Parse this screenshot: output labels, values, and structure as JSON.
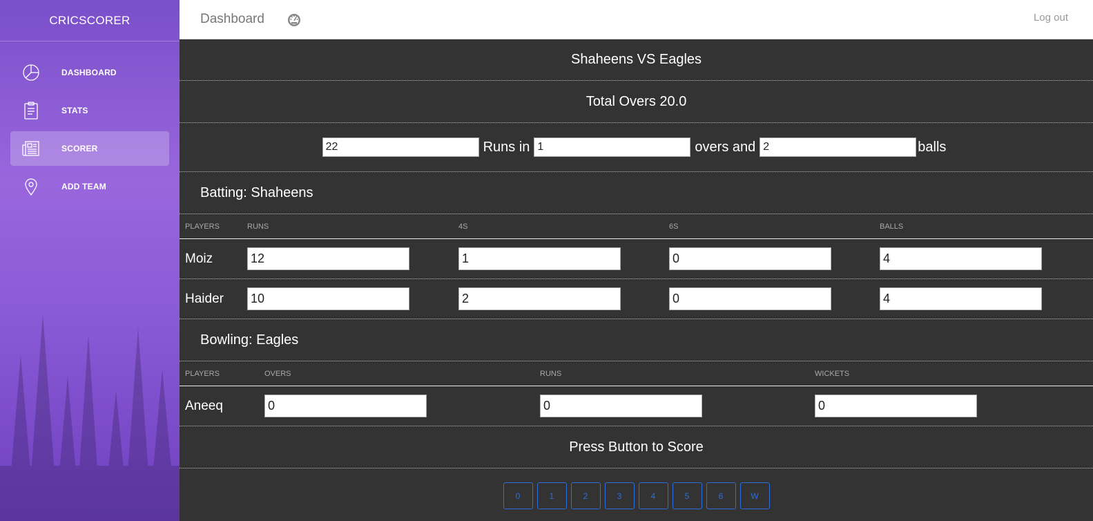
{
  "sidebar": {
    "brand": "CRICSCORER",
    "items": [
      {
        "label": "DASHBOARD",
        "icon": "pie-chart-icon"
      },
      {
        "label": "STATS",
        "icon": "clipboard-icon"
      },
      {
        "label": "SCORER",
        "icon": "newspaper-icon",
        "active": true
      },
      {
        "label": "ADD TEAM",
        "icon": "map-pin-icon"
      }
    ]
  },
  "topbar": {
    "title": "Dashboard",
    "icon": "dashboard-gauge-icon",
    "logout": "Log out"
  },
  "match": {
    "title": "Shaheens VS Eagles",
    "total_overs": "Total Overs 20.0",
    "runs_value": "22",
    "runs_label": "Runs in",
    "overs_value": "1",
    "overs_label": "overs and",
    "balls_value": "2",
    "balls_label": "balls"
  },
  "batting": {
    "heading": "Batting: Shaheens",
    "columns": [
      "PLAYERS",
      "RUNS",
      "4S",
      "6S",
      "BALLS"
    ],
    "rows": [
      {
        "player": "Moiz",
        "runs": "12",
        "fours": "1",
        "sixes": "0",
        "balls": "4"
      },
      {
        "player": "Haider",
        "runs": "10",
        "fours": "2",
        "sixes": "0",
        "balls": "4"
      }
    ]
  },
  "bowling": {
    "heading": "Bowling: Eagles",
    "columns": [
      "PLAYERS",
      "OVERS",
      "RUNS",
      "WICKETS"
    ],
    "rows": [
      {
        "player": "Aneeq",
        "overs": "0",
        "runs": "0",
        "wickets": "0"
      }
    ]
  },
  "scoring": {
    "prompt": "Press Button to Score",
    "buttons": [
      "0",
      "1",
      "2",
      "3",
      "4",
      "5",
      "6",
      "W"
    ]
  },
  "colors": {
    "sidebar_accent": "#8a5bd6",
    "main_bg": "#333333",
    "button_blue": "#2e6edc"
  }
}
